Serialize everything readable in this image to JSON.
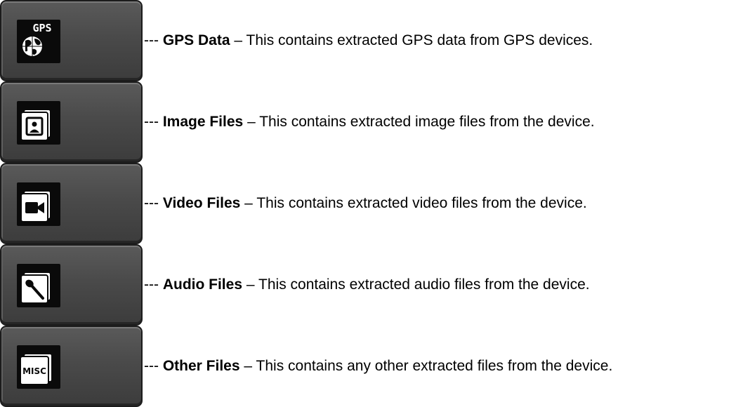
{
  "items": [
    {
      "icon": "gps-globe-icon",
      "icon_label": "GPS",
      "prefix": "---",
      "title": "GPS Data",
      "separator": "–",
      "description": "This contains extracted GPS data from GPS devices."
    },
    {
      "icon": "image-files-icon",
      "icon_label": "",
      "prefix": "---",
      "title": "Image Files",
      "separator": "–",
      "description": "This contains extracted image files from the device."
    },
    {
      "icon": "video-camera-icon",
      "icon_label": "",
      "prefix": "---",
      "title": "Video Files",
      "separator": "–",
      "description": "This contains extracted video files from the device."
    },
    {
      "icon": "microphone-icon",
      "icon_label": "",
      "prefix": "---",
      "title": "Audio Files",
      "separator": "–",
      "description": "This contains extracted audio files from the device."
    },
    {
      "icon": "misc-files-icon",
      "icon_label": "MISC",
      "prefix": "---",
      "title": "Other Files",
      "separator": "–",
      "description": "This contains any other extracted files from the device."
    }
  ]
}
